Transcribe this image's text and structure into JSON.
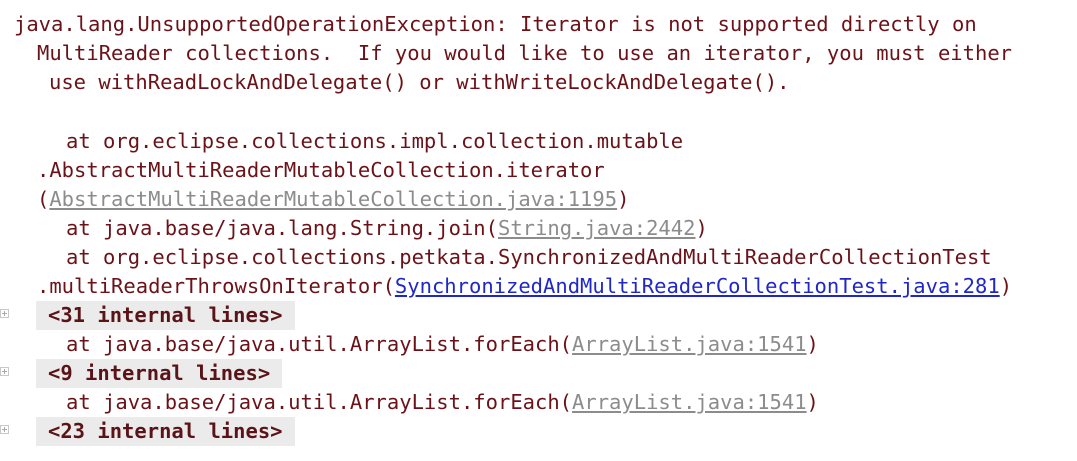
{
  "exception": {
    "line1": "java.lang.UnsupportedOperationException: Iterator is not supported directly on",
    "line2": "MultiReader collections.  If you would like to use an iterator, you must either",
    "line3": "use withReadLockAndDelegate() or withWriteLockAndDelegate()."
  },
  "frames": [
    {
      "prefix1": "at org.eclipse.collections.impl.collection.mutable",
      "prefix2": ".AbstractMultiReaderMutableCollection.iterator",
      "open": "(",
      "link": "AbstractMultiReaderMutableCollection.java:1195",
      "close": ")"
    },
    {
      "prefix": "at java.base/java.lang.String.join(",
      "link": "String.java:2442",
      "close": ")"
    },
    {
      "prefix1": "at org.eclipse.collections.petkata.SynchronizedAndMultiReaderCollectionTest",
      "prefix2": ".multiReaderThrowsOnIterator(",
      "link": "SynchronizedAndMultiReaderCollectionTest.java:281",
      "close": ")"
    },
    {
      "prefix": "at java.base/java.util.ArrayList.forEach(",
      "link": "ArrayList.java:1541",
      "close": ")"
    },
    {
      "prefix": "at java.base/java.util.ArrayList.forEach(",
      "link": "ArrayList.java:1541",
      "close": ")"
    }
  ],
  "folds": [
    {
      "label": "<31 internal lines>"
    },
    {
      "label": "<9 internal lines>"
    },
    {
      "label": "<23 internal lines>"
    }
  ],
  "colors": {
    "text": "#6b1219",
    "link_grey": "#8c8c8c",
    "link_blue": "#1f28c7",
    "fold_bg": "#ebebeb"
  }
}
